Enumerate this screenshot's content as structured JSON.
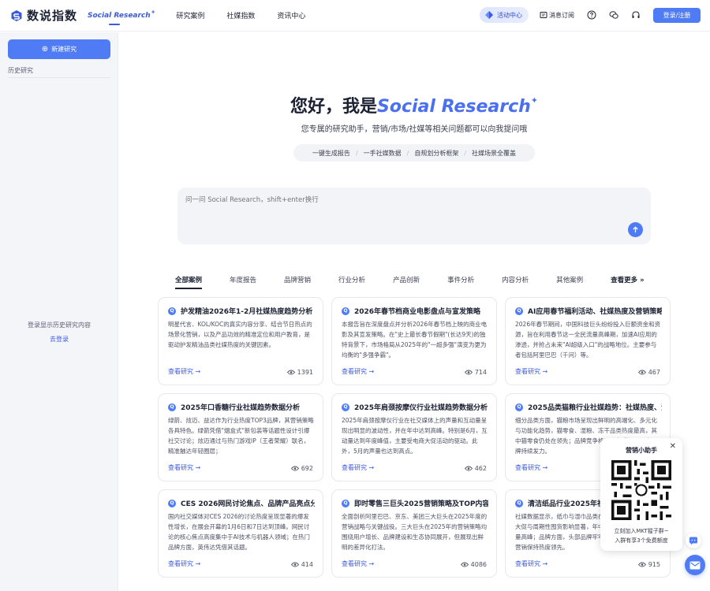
{
  "header": {
    "logo_text": "数说指数",
    "nav": [
      {
        "label": "Social Research",
        "active": true
      },
      {
        "label": "研究案例"
      },
      {
        "label": "社媒指数"
      },
      {
        "label": "资讯中心"
      }
    ],
    "activity_label": "活动中心",
    "subscribe_label": "消息订阅",
    "login_label": "登录/注册",
    "accent_color": "#4f7cf5",
    "icons": [
      "help-icon",
      "wechat-icon",
      "headset-icon"
    ]
  },
  "sidebar": {
    "new_button": "新建研究",
    "history_title": "历史研究",
    "empty_tip": "登录显示历史研究内容",
    "login_link": "去登录"
  },
  "hero": {
    "greeting": "您好，我是",
    "brand": "Social Research",
    "subtitle": "您专属的研究助手，营销/市场/社媒等相关问题都可以向我提问哦",
    "pills": [
      "一键生成报告",
      "一手社媒数据",
      "自规划分析框架",
      "社媒场景全覆盖"
    ]
  },
  "ask": {
    "placeholder": "问一问 Social Research，shift+enter换行"
  },
  "tabs": {
    "items": [
      "全部案例",
      "年度报告",
      "品牌营销",
      "行业分析",
      "产品创新",
      "事件分析",
      "内容分析",
      "其他案例"
    ],
    "more": "查看更多"
  },
  "cards": [
    {
      "title": "护发精油2026年1-2月社媒热度趋势分析",
      "desc": "明星代言、KOL/KOC的真实内容分享、结合节日热点的场景化营销，以及产品功效的精准定位和用户教育，是驱动护发精油品类社媒热度的关键因素。",
      "link": "查看研究",
      "views": "1391"
    },
    {
      "title": "2026年春节档商业电影盘点与宣发策略",
      "desc": "本报告旨在深度盘点并分析2026年春节档上映的商业电影及其宣发策略。在\"史上最长春节假期\"(长达9天)的独特背景下，市场格局从2025年的\"一超多强\"演变为更为均衡的\"多强争霸\"。",
      "link": "查看研究",
      "views": "714"
    },
    {
      "title": "AI应用春节福利活动、社媒热度及营销策略",
      "desc": "2026年春节期间，中国科技巨头纷纷投入巨额资金和资源，旨在利用春节这一全民流量高峰期，加速AI应用的渗透，并抢占未来\"AI超级入口\"的战略地位。主要参与者包括阿里巴巴（千问）等。",
      "link": "查看研究",
      "views": "467"
    },
    {
      "title": "2025年口香糖行业社媒趋势数据分析",
      "desc": "绿箭、炫迈、益达作为行业热度TOP3品牌，其营销策略各具特色。绿箭凭借\"烟盒式\"新包装等话题性设计引爆社交讨论；炫迈通过与热门游戏IP（王者荣耀）联名，精准触达年轻圈层；",
      "link": "查看研究",
      "views": "692"
    },
    {
      "title": "2025年肩颈按摩仪行业社媒趋势数据分析",
      "desc": "2025年肩颈按摩仪行业在社交媒体上的声量和互动量呈现出明显的波动性，并在年中达到高峰。特别是6月，互动量达到年度峰值，主要受电商大促活动的驱动。此外，5月的声量也达到高点。",
      "link": "查看研究",
      "views": "462"
    },
    {
      "title": "2025品类猫粮行业社媒趋势：社媒热度、消费趋势",
      "desc": "细分品类方面，猫粮市场呈现出鲜明的高端化、多元化与功能化趋势，猫零食、湿粮、冻干品类热度最高，其中猫零食仍处在领先；品牌竞争格局正在重塑，国产品牌持续发力。",
      "link": "查看研究",
      "views": "915"
    },
    {
      "title": "CES 2026网民讨论焦点、品牌产品亮点分析",
      "desc": "国内社交媒体对CES 2026的讨论热度呈现显著的爆发性增长，在展会开幕的1月6日和7日达到顶峰。网民讨论的核心焦点高度集中于AI技术与机器人领域；在热门品牌方面，英伟达凭借其话题。",
      "link": "查看研究",
      "views": "414"
    },
    {
      "title": "即时零售三巨头2025营销策略及TOP内容分析",
      "desc": "全面剖析阿里巴巴、京东、美团三大巨头在2025年度的营销战略与关键战役。三大巨头在2025年的营销策略均围绕用户增长、品牌建设和生态协同展开，但展现出鲜明的差异化打法。",
      "link": "查看研究",
      "views": "4086"
    },
    {
      "title": "清洁纸品行业2025年社媒趋势与品牌分析",
      "desc": "社媒数据显示，纸巾与湿巾品类在社媒上的声量受电商大促与周期性囤货影响显著，年中与年末购物季形成声量高峰；品牌方面，头部品牌牢牢占据心智，借助社媒营销保持热度领先。",
      "link": "查看研究",
      "views": "915"
    }
  ],
  "assistant_popup": {
    "title": "营销小助手",
    "desc_line1": "立刻加入MKT猩子群~",
    "desc_line2": "入群有享3个免费额度"
  }
}
